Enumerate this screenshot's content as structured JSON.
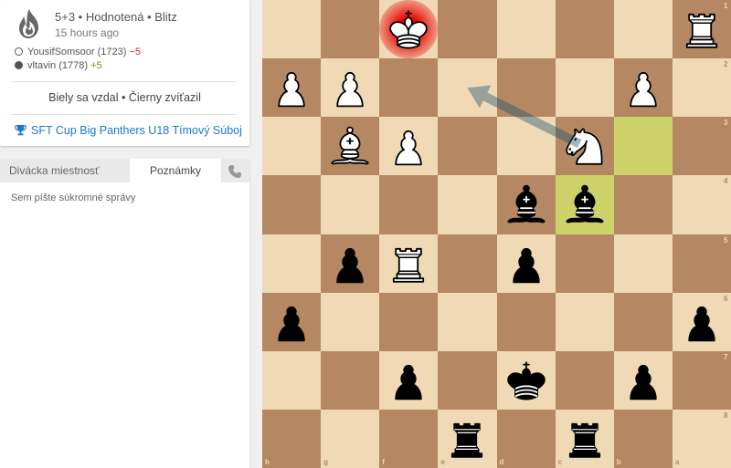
{
  "game": {
    "time_control": "5+3 • Hodnotená • Blitz",
    "played_ago": "15 hours ago",
    "players": [
      {
        "color": "white",
        "name": "YousifSomsoor (1723)",
        "diff": "−5",
        "diff_type": "neg"
      },
      {
        "color": "black",
        "name": "vltavin (1778)",
        "diff": "+5",
        "diff_type": "pos"
      }
    ],
    "result": "Biely sa vzdal • Čierny zvíťazil",
    "tournament": "SFT Cup Big Panthers U18 Tímový Súboj",
    "icon": "fire-icon"
  },
  "panel": {
    "tab_chat": "Divácka miestnosť",
    "tab_notes": "Poznámky",
    "notes_placeholder": "Sem píšte súkromné správy",
    "phone_icon": "phone-icon"
  },
  "board": {
    "orientation": "black",
    "ranks": [
      "1",
      "2",
      "3",
      "4",
      "5",
      "6",
      "7",
      "8"
    ],
    "files": [
      "h",
      "g",
      "f",
      "e",
      "d",
      "c",
      "b",
      "a"
    ],
    "pieces": [
      {
        "sq": "f1",
        "type": "K",
        "color": "w"
      },
      {
        "sq": "a1",
        "type": "R",
        "color": "w"
      },
      {
        "sq": "h2",
        "type": "P",
        "color": "w"
      },
      {
        "sq": "g2",
        "type": "P",
        "color": "w"
      },
      {
        "sq": "b2",
        "type": "P",
        "color": "w"
      },
      {
        "sq": "g3",
        "type": "B",
        "color": "w"
      },
      {
        "sq": "f3",
        "type": "P",
        "color": "w"
      },
      {
        "sq": "c3",
        "type": "N",
        "color": "w"
      },
      {
        "sq": "d4",
        "type": "B",
        "color": "b"
      },
      {
        "sq": "c4",
        "type": "B",
        "color": "b"
      },
      {
        "sq": "g5",
        "type": "P",
        "color": "b"
      },
      {
        "sq": "f5",
        "type": "R",
        "color": "w"
      },
      {
        "sq": "d5",
        "type": "P",
        "color": "b"
      },
      {
        "sq": "h6",
        "type": "P",
        "color": "b"
      },
      {
        "sq": "a6",
        "type": "P",
        "color": "b"
      },
      {
        "sq": "f7",
        "type": "P",
        "color": "b"
      },
      {
        "sq": "d7",
        "type": "K",
        "color": "b"
      },
      {
        "sq": "b7",
        "type": "P",
        "color": "b"
      },
      {
        "sq": "e8",
        "type": "R",
        "color": "b"
      },
      {
        "sq": "c8",
        "type": "R",
        "color": "b"
      }
    ],
    "last_move": [
      "b3",
      "c4"
    ],
    "check": "f1",
    "arrow": {
      "from": "c3",
      "to": "e2"
    },
    "colors": {
      "light": "#f0d9b5",
      "dark": "#b58863",
      "highlight": "#cdd26a",
      "arrow": "#15506e"
    }
  }
}
